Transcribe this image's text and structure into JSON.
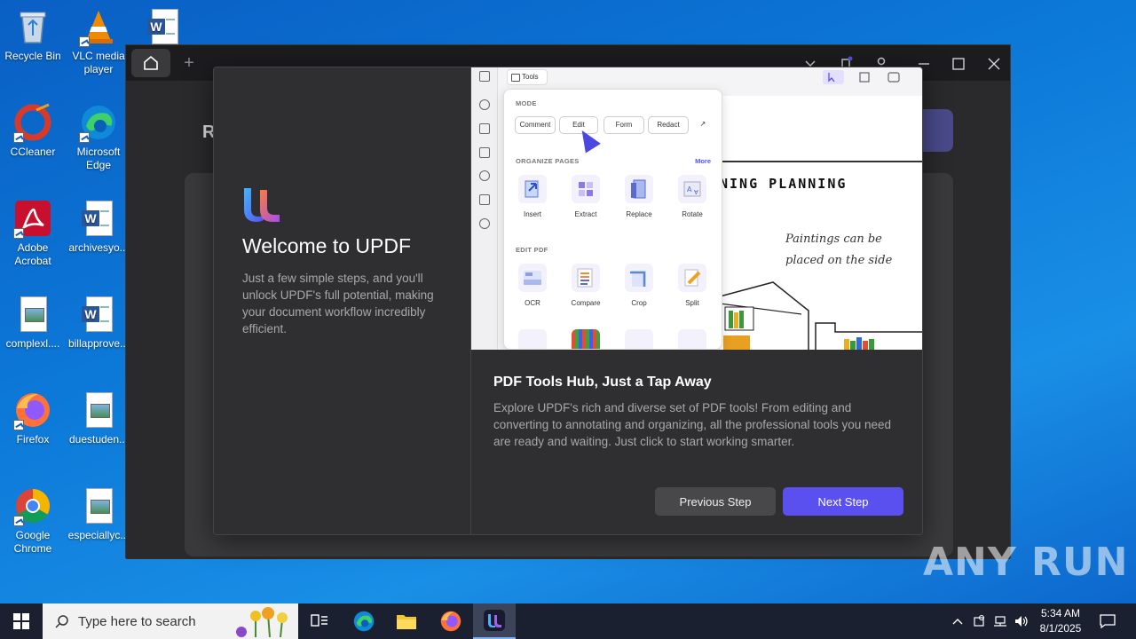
{
  "desktop": {
    "icons": [
      {
        "label": "Recycle Bin"
      },
      {
        "label": "VLC media player"
      },
      {
        "label": "CCleaner"
      },
      {
        "label": "Microsoft Edge"
      },
      {
        "label": "Adobe Acrobat"
      },
      {
        "label": "archivesyo..."
      },
      {
        "label": "complexl...."
      },
      {
        "label": "billapprove..."
      },
      {
        "label": "Firefox"
      },
      {
        "label": "duestuden..."
      },
      {
        "label": "Google Chrome"
      },
      {
        "label": "especiallyc..."
      }
    ]
  },
  "app": {
    "background_heading": "R",
    "dialog": {
      "welcome_title": "Welcome to UPDF",
      "welcome_desc": "Just a few simple steps, and you'll unlock UPDF's full potential, making your document workflow incredibly efficient.",
      "step_title": "PDF Tools Hub, Just a Tap Away",
      "step_desc": "Explore UPDF's rich and diverse set of PDF tools! From editing and converting to annotating and organizing, all the professional tools you need are ready and waiting. Just click to start working smarter.",
      "prev_label": "Previous Step",
      "next_label": "Next Step",
      "preview": {
        "tools_label": "Tools",
        "mode_heading": "MODE",
        "mode_buttons": [
          "Comment",
          "Edit",
          "Form",
          "Redact"
        ],
        "organize_heading": "ORGANIZE PAGES",
        "more_label": "More",
        "organize_tools": [
          "Insert",
          "Extract",
          "Replace",
          "Rotate"
        ],
        "edit_heading": "EDIT PDF",
        "edit_tools": [
          "OCR",
          "Compare",
          "Crop",
          "Split"
        ],
        "doc_title": "NING PLANNING",
        "doc_note_1": "Paintings can be",
        "doc_note_2": "placed on the side"
      }
    }
  },
  "taskbar": {
    "search_placeholder": "Type here to search",
    "time": "5:34 AM",
    "date": "8/1/2025"
  },
  "watermark": "ANY RUN",
  "colors": {
    "accent": "#5a50f0",
    "dialog_bg": "#2f2f31",
    "desktop_blue": "#0c79d8"
  }
}
